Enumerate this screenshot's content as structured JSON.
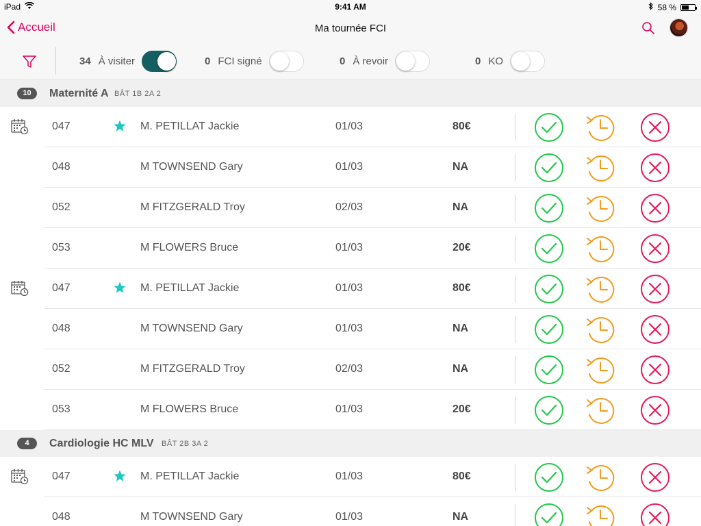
{
  "status_bar": {
    "device": "iPad",
    "time": "9:41 AM",
    "battery": "58 %",
    "battery_level": 0.58
  },
  "nav": {
    "back_label": "Accueil",
    "title": "Ma tournée FCI"
  },
  "filters": [
    {
      "count": "34",
      "label": "À visiter",
      "on": true
    },
    {
      "count": "0",
      "label": "FCI signé",
      "on": false
    },
    {
      "count": "0",
      "label": "À revoir",
      "on": false
    },
    {
      "count": "0",
      "label": "KO",
      "on": false
    }
  ],
  "sections": [
    {
      "count": "10",
      "name": "Maternité A",
      "bat": "BÂT  1B 2A 2",
      "rows": [
        {
          "calendar": true,
          "num": "047",
          "star": true,
          "name": "M. PETILLAT Jackie",
          "date": "01/03",
          "amount": "80€"
        },
        {
          "calendar": false,
          "num": "048",
          "star": false,
          "name": "M TOWNSEND Gary",
          "date": "01/03",
          "amount": "NA"
        },
        {
          "calendar": false,
          "num": "052",
          "star": false,
          "name": "M FITZGERALD Troy",
          "date": "02/03",
          "amount": "NA"
        },
        {
          "calendar": false,
          "num": "053",
          "star": false,
          "name": "M FLOWERS Bruce",
          "date": "01/03",
          "amount": "20€"
        },
        {
          "calendar": true,
          "num": "047",
          "star": true,
          "name": "M. PETILLAT Jackie",
          "date": "01/03",
          "amount": "80€"
        },
        {
          "calendar": false,
          "num": "048",
          "star": false,
          "name": "M TOWNSEND Gary",
          "date": "01/03",
          "amount": "NA"
        },
        {
          "calendar": false,
          "num": "052",
          "star": false,
          "name": "M FITZGERALD Troy",
          "date": "02/03",
          "amount": "NA"
        },
        {
          "calendar": false,
          "num": "053",
          "star": false,
          "name": "M FLOWERS Bruce",
          "date": "01/03",
          "amount": "20€"
        }
      ]
    },
    {
      "count": "4",
      "name": "Cardiologie HC MLV",
      "bat": "BÂT  2B 3A 2",
      "rows": [
        {
          "calendar": true,
          "num": "047",
          "star": true,
          "name": "M. PETILLAT Jackie",
          "date": "01/03",
          "amount": "80€"
        },
        {
          "calendar": false,
          "num": "048",
          "star": false,
          "name": "M TOWNSEND Gary",
          "date": "01/03",
          "amount": "NA"
        }
      ]
    }
  ],
  "colors": {
    "accent": "#e0005a",
    "toggle_on": "#155f62",
    "ok": "#22c84a",
    "revisit": "#f59a1b",
    "ko": "#e8185a",
    "star": "#1fc7c0"
  }
}
